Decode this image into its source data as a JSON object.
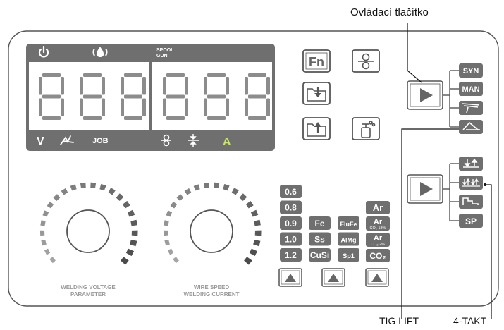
{
  "callouts": {
    "control_button": "Ovládací tlačítko",
    "tig_lift": "TIG LIFT",
    "four_takt": "4-TAKT"
  },
  "display": {
    "top_labels": {
      "spool_line1": "SPOOL",
      "spool_line2": "GUN"
    },
    "left_digits": "888",
    "right_digits": "888",
    "bottom_labels": {
      "volt": "V",
      "job": "JOB",
      "amp": "A"
    }
  },
  "function_buttons": {
    "fn": "Fn"
  },
  "mode_labels": [
    "SYN",
    "MAN"
  ],
  "trigger_labels": [
    "SP"
  ],
  "wire_diameters": [
    "0.6",
    "0.8",
    "0.9",
    "1.0",
    "1.2"
  ],
  "materials": [
    "Fe",
    "Ss",
    "CuSi"
  ],
  "materials2": [
    "FluFe",
    "AlMg",
    "Sp1"
  ],
  "gases": {
    "ar": "Ar",
    "ar18_main": "Ar",
    "ar18_sub": "CO₂ 18%",
    "ar2_main": "Ar",
    "ar2_sub": "CO₂ 2%",
    "co2": "CO₂"
  },
  "knobs": {
    "left_line1": "WELDING VOLTAGE",
    "left_line2": "PARAMETER",
    "right_line1": "WIRE SPEED",
    "right_line2": "WELDING CURRENT"
  },
  "colors": {
    "panel_gray": "#6f6f6f",
    "led_off": "#8c8c8c",
    "accent_green": "#c9e66a",
    "outline": "#444444",
    "background": "#ffffff"
  }
}
